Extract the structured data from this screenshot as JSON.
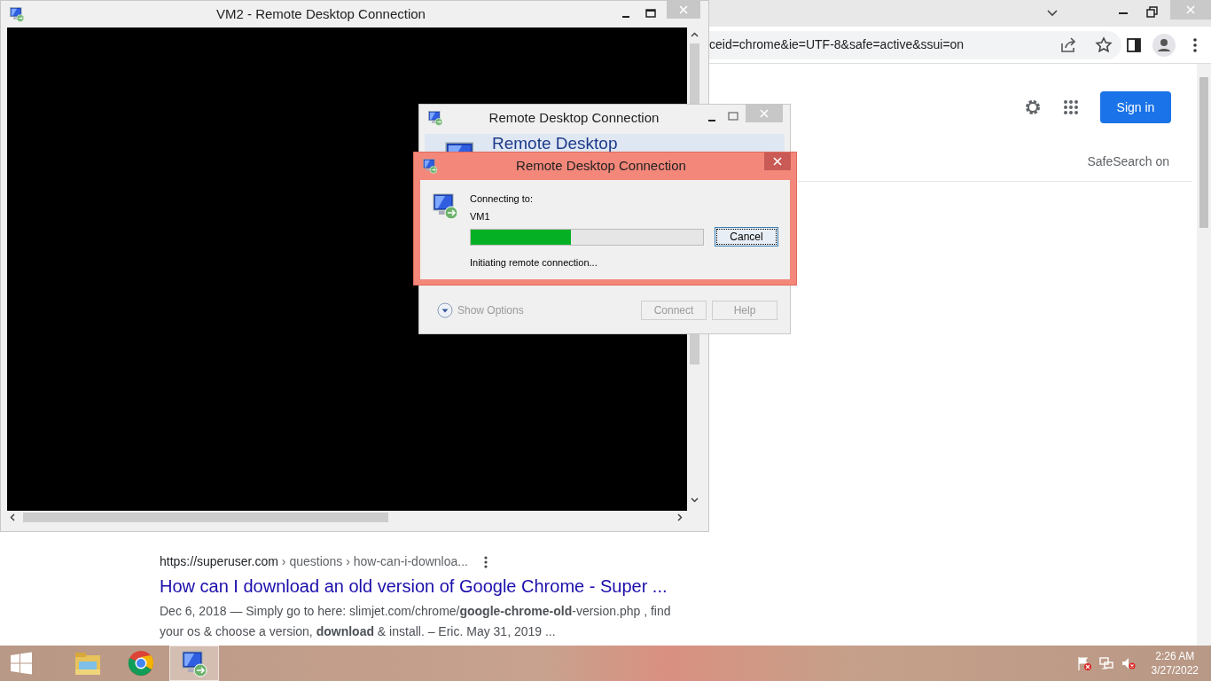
{
  "browser": {
    "url": "ceid=chrome&ie=UTF-8&safe=active&ssui=on",
    "sign_in": "Sign in",
    "safesearch": "SafeSearch on",
    "result": {
      "site": "https://superuser.com",
      "path": "› questions › how-can-i-downloa...",
      "title": "How can I download an old version of Google Chrome - Super ...",
      "snippet": "Dec 6, 2018 — Simply go to here: slimjet.com/chrome/**google-chrome-old**-version.php , find your os & choose a version, **download** & install. – Eric. May 31, 2019 ..."
    }
  },
  "remote_window": {
    "title": "VM2 - Remote Desktop Connection"
  },
  "connection_dialog": {
    "title": "Remote Desktop Connection",
    "banner": "Remote Desktop",
    "show_options": "Show Options",
    "buttons": [
      {
        "label": "Connect",
        "disabled": true
      },
      {
        "label": "Help",
        "disabled": true
      }
    ]
  },
  "progress_dialog": {
    "title": "Remote Desktop Connection",
    "connecting_label": "Connecting to:",
    "computer": "VM1",
    "level": 0.43,
    "status": "Initiating remote connection...",
    "cancel": "Cancel"
  },
  "taskbar": {
    "apps": [
      {
        "kind": "explorer",
        "selected": false
      },
      {
        "kind": "chrome",
        "selected": false
      },
      {
        "kind": "rdp",
        "selected": true
      }
    ],
    "time": "2:26 AM",
    "date": "3/27/2022"
  }
}
